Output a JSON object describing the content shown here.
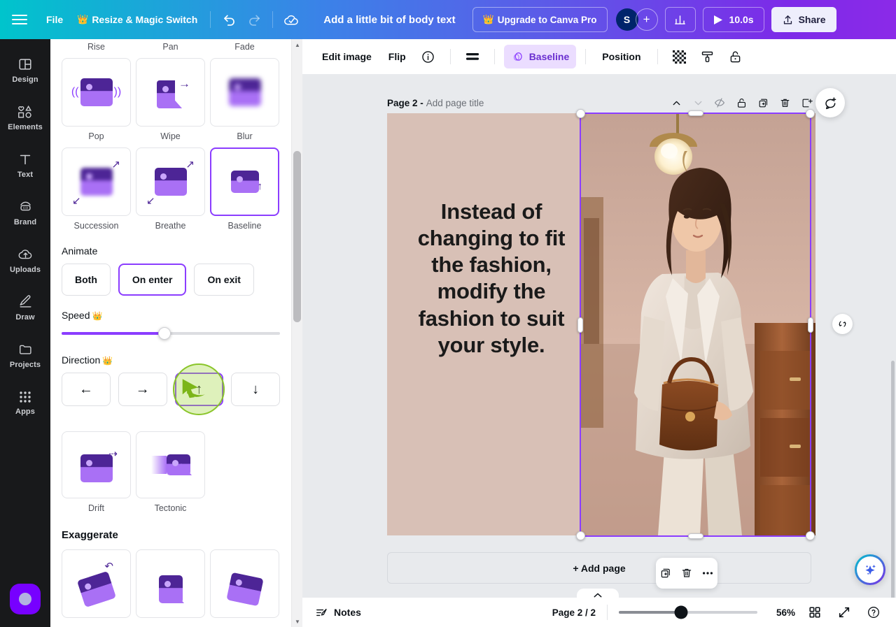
{
  "topbar": {
    "menu_icon": "hamburger-icon",
    "file_label": "File",
    "resize_label": "Resize & Magic Switch",
    "undo_icon": "undo-icon",
    "redo_icon": "redo-icon",
    "cloud_icon": "cloud-saved-icon",
    "doc_title": "Add a little bit of body text",
    "upgrade_label": "Upgrade to Canva Pro",
    "avatar_initial": "S",
    "add_collaborator_label": "+",
    "insights_icon": "insights-bar-chart-icon",
    "play_icon": "play-icon",
    "duration_label": "10.0s",
    "share_icon": "share-upload-icon",
    "share_label": "Share"
  },
  "rail": {
    "items": [
      {
        "label": "Design",
        "icon": "design-layout-icon"
      },
      {
        "label": "Elements",
        "icon": "elements-shapes-icon"
      },
      {
        "label": "Text",
        "icon": "text-t-icon"
      },
      {
        "label": "Brand",
        "icon": "brand-icon"
      },
      {
        "label": "Uploads",
        "icon": "uploads-cloud-icon"
      },
      {
        "label": "Draw",
        "icon": "draw-pencil-icon"
      },
      {
        "label": "Projects",
        "icon": "projects-folder-icon"
      },
      {
        "label": "Apps",
        "icon": "apps-grid-icon"
      }
    ],
    "bottom_button_icon": "recording-dot-icon"
  },
  "panel": {
    "row1_labels": [
      "Rise",
      "Pan",
      "Fade"
    ],
    "row2": [
      {
        "label": "Pop",
        "icon": "pop-animation-icon",
        "selected": false
      },
      {
        "label": "Wipe",
        "icon": "wipe-animation-icon",
        "selected": false
      },
      {
        "label": "Blur",
        "icon": "blur-animation-icon",
        "selected": false
      }
    ],
    "row3": [
      {
        "label": "Succession",
        "icon": "succession-animation-icon",
        "selected": false
      },
      {
        "label": "Breathe",
        "icon": "breathe-animation-icon",
        "selected": false
      },
      {
        "label": "Baseline",
        "icon": "baseline-animation-icon",
        "selected": true
      }
    ],
    "animate_title": "Animate",
    "animate_options": [
      {
        "label": "Both",
        "active": false
      },
      {
        "label": "On enter",
        "active": true
      },
      {
        "label": "On exit",
        "active": false
      }
    ],
    "speed_title": "Speed",
    "speed_crown": "♛",
    "speed_value_percent": 47,
    "direction_title": "Direction",
    "direction_crown": "♛",
    "direction_options": [
      {
        "icon": "arrow-left-icon",
        "glyph": "←",
        "active": false
      },
      {
        "icon": "arrow-right-icon",
        "glyph": "→",
        "active": false
      },
      {
        "icon": "arrow-up-icon",
        "glyph": "↑",
        "active": true
      },
      {
        "icon": "arrow-down-icon",
        "glyph": "↓",
        "active": false
      }
    ],
    "row4": [
      {
        "label": "Drift",
        "icon": "drift-animation-icon"
      },
      {
        "label": "Tectonic",
        "icon": "tectonic-animation-icon"
      }
    ],
    "exaggerate_title": "Exaggerate",
    "exaggerate_icons": [
      "tumble-animation-icon",
      "flip-animation-icon",
      "skate-animation-icon"
    ]
  },
  "context_toolbar": {
    "edit_image_label": "Edit image",
    "flip_label": "Flip",
    "info_icon": "info-circle-icon",
    "lines_icon": "align-lines-icon",
    "animate_icon": "animate-rings-icon",
    "animate_label": "Baseline",
    "position_label": "Position",
    "transparency_icon": "transparency-checker-icon",
    "copy_style_icon": "paint-roller-icon",
    "lock_icon": "lock-open-icon"
  },
  "page": {
    "number_label": "Page 2 -",
    "title_placeholder": "Add page title",
    "tools": [
      {
        "icon": "chevron-up-icon",
        "name": "move-page-up"
      },
      {
        "icon": "chevron-down-icon",
        "name": "move-page-down"
      },
      {
        "icon": "hide-page-eye-icon",
        "name": "hide-page"
      },
      {
        "icon": "lock-open-icon",
        "name": "lock-page"
      },
      {
        "icon": "duplicate-page-icon",
        "name": "duplicate-page"
      },
      {
        "icon": "trash-icon",
        "name": "delete-page"
      },
      {
        "icon": "export-page-icon",
        "name": "export-page"
      }
    ],
    "canvas_text": "Instead of changing to fit the fashion, modify the fashion to suit your style.",
    "canvas_bg": "#d8c0b6",
    "selection_color": "#8b3dff",
    "add_page_label": "+ Add page",
    "float_tools": [
      {
        "icon": "duplicate-page-icon",
        "name": "duplicate-page-float"
      },
      {
        "icon": "trash-icon",
        "name": "delete-page-float"
      },
      {
        "icon": "more-dots-icon",
        "name": "more-options-float"
      }
    ],
    "comment_icon": "add-comment-icon",
    "rotate_icon": "rotate-handle-icon",
    "magic_icon": "magic-sparkle-icon"
  },
  "statusbar": {
    "notes_icon": "notes-icon",
    "notes_label": "Notes",
    "page_count_label": "Page 2 / 2",
    "zoom_value": "56%",
    "zoom_percent": 45,
    "grid_icon": "grid-view-icon",
    "fullscreen_icon": "fullscreen-expand-icon",
    "help_icon": "help-question-icon"
  }
}
